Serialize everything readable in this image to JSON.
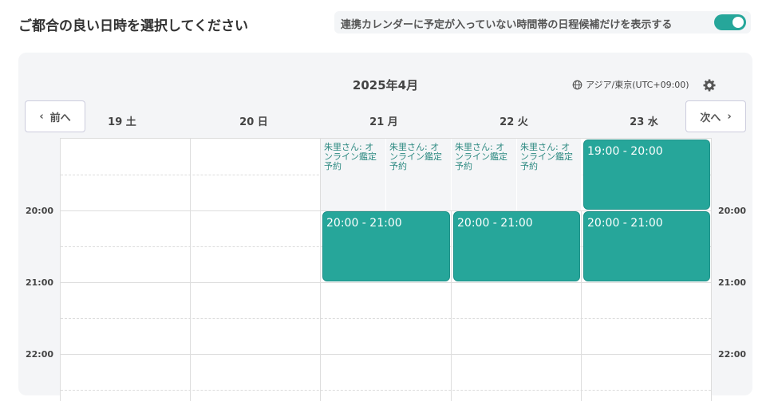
{
  "header": {
    "title": "ご都合の良い日時を選択してください",
    "filter_label": "連携カレンダーに予定が入っていない時間帯の日程候補だけを表示する",
    "toggle_on": true,
    "accent_color": "#26a69a"
  },
  "calendar": {
    "month_label": "2025年4月",
    "timezone": "アジア/東京(UTC+09:00)",
    "prev_label": "前へ",
    "next_label": "次へ",
    "days": [
      {
        "num": "19",
        "dow": "土"
      },
      {
        "num": "20",
        "dow": "日"
      },
      {
        "num": "21",
        "dow": "月"
      },
      {
        "num": "22",
        "dow": "火"
      },
      {
        "num": "23",
        "dow": "水"
      }
    ],
    "hours": [
      "20:00",
      "21:00",
      "22:00"
    ],
    "busy": [
      {
        "text": "朱里さん: オンライン鑑定予約"
      },
      {
        "text": "朱里さん: オンライン鑑定予約"
      },
      {
        "text": "朱里さん: オンライン鑑定予約"
      },
      {
        "text": "朱里さん: オンライン鑑定予約"
      }
    ],
    "slots": [
      {
        "label": "19:00 - 20:00"
      },
      {
        "label": "20:00 - 21:00"
      },
      {
        "label": "20:00 - 21:00"
      },
      {
        "label": "20:00 - 21:00"
      }
    ]
  }
}
